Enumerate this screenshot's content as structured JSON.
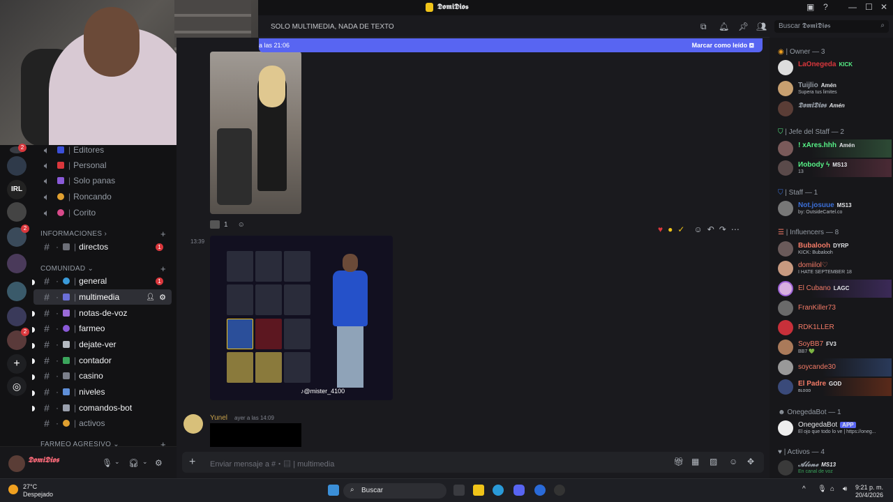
{
  "window": {
    "title": "𝕯𝖔𝖒𝖎𝕯𝖎𝖔𝖘",
    "min": "—",
    "max": "☐",
    "close": "✕"
  },
  "header": {
    "channel": "SOLO MULTIMEDIA, NADA DE TEXTO",
    "search_placeholder": "Buscar 𝕯𝖔𝖒𝖎𝕯𝖎𝖔𝖘"
  },
  "banner": {
    "left": "a las 21:06",
    "right": "Marcar como leído"
  },
  "voice_channels": [
    {
      "label": "Editores",
      "color": "#3b4fd8"
    },
    {
      "label": "Personal",
      "color": "#da373c"
    },
    {
      "label": "Solo panas",
      "color": "#8a5ad8"
    },
    {
      "label": "Roncando",
      "color": "#e0a030"
    },
    {
      "label": "Corito",
      "color": "#d84a8a"
    }
  ],
  "categories": {
    "info": "INFORMACIONES",
    "community": "COMUNIDAD",
    "farm": "FARMEO AGRESIVO"
  },
  "info_channels": [
    {
      "label": "directos",
      "mention": "1",
      "color": "#6d6f78"
    }
  ],
  "community_channels": [
    {
      "label": "general",
      "mention": "1",
      "color": "#3a9ad9"
    },
    {
      "label": "multimedia",
      "color": "#6b70d8"
    },
    {
      "label": "notas-de-voz",
      "color": "#9a6bd8"
    },
    {
      "label": "farmeo",
      "color": "#8a5ad8"
    },
    {
      "label": "dejate-ver",
      "color": "#b5bac1"
    },
    {
      "label": "contador",
      "color": "#3ba55c"
    },
    {
      "label": "casino",
      "color": "#7b7f8a"
    },
    {
      "label": "niveles",
      "color": "#5f8fd8"
    },
    {
      "label": "comandos-bot",
      "color": "#9aa0ad"
    },
    {
      "label": "activos",
      "color": "#e0a030"
    }
  ],
  "user": {
    "name": "𝕯𝖔𝖒𝖎𝕯𝖎𝖔𝖘"
  },
  "messages": {
    "reaction_count": "1",
    "time": "13:39",
    "tiktok": "♪@mister_4100",
    "next_author": "Yunel",
    "next_time": "ayer a las 14:09"
  },
  "input": {
    "placeholder": "Enviar mensaje a #・▤ | multimedia"
  },
  "members": {
    "groups": [
      {
        "label": "| Owner — 3"
      },
      {
        "label": "| Jefe del Staff — 2"
      },
      {
        "label": "| Staff — 1"
      },
      {
        "label": "| Influencers — 8"
      },
      {
        "label": "OnegedaBot — 1"
      },
      {
        "label": "| Activos — 4"
      }
    ],
    "list": [
      {
        "name": "LaOnegeda",
        "tag": "KICK",
        "sub": "",
        "color": "#da373c"
      },
      {
        "name": "Tuijlio",
        "tag": "Amén",
        "sub": "Supera tus limites",
        "color": "#949ba4"
      },
      {
        "name": "𝕯𝖔𝖒𝖎𝕯𝖎𝖔𝖘",
        "tag": "Amén",
        "sub": "",
        "color": "#949ba4"
      },
      {
        "name": "! xAres.hhh",
        "tag": "Amén",
        "sub": "",
        "color": "#57f287"
      },
      {
        "name": "Иobody ϟ",
        "tag": "MS13",
        "sub": "13",
        "color": "#57f287"
      },
      {
        "name": "Not.josuue",
        "tag": "MS13",
        "sub": "by: OutsideCartel.co",
        "color": "#3b6fd8"
      },
      {
        "name": "Bubalooh",
        "tag": "DYRP",
        "sub": "KICK: Bubalooh",
        "color": "#f47b67"
      },
      {
        "name": "domiilol♡",
        "tag": "",
        "sub": "I HATE SEPTEMBER 18",
        "color": "#f47b67"
      },
      {
        "name": "El Cubano",
        "tag": "LAGC",
        "sub": "",
        "color": "#f47b67"
      },
      {
        "name": "FranKiller73",
        "tag": "",
        "sub": "",
        "color": "#f47b67"
      },
      {
        "name": "RDK1LLER",
        "tag": "",
        "sub": "",
        "color": "#f47b67"
      },
      {
        "name": "SoyBB7",
        "tag": "FV3",
        "sub": "BB7 💚",
        "color": "#f47b67"
      },
      {
        "name": "soycande30",
        "tag": "",
        "sub": "",
        "color": "#f47b67"
      },
      {
        "name": "El Padre",
        "tag": "GOD",
        "sub": "ʙʟᴏᴏᴅ",
        "color": "#f47b67"
      },
      {
        "name": "OnegedaBot",
        "tag": "APP",
        "sub": "El ojo que todo lo ve | https://oneg...",
        "color": "#e5e6e8"
      },
      {
        "name": "𝓐𝓵𝓸𝓷𝓮",
        "tag": "MS13",
        "sub": "En canal de voz",
        "color": "#949ba4"
      }
    ]
  },
  "taskbar": {
    "temp": "27°C",
    "weather": "Despejado",
    "search": "Buscar",
    "time": "9:21 p. m.",
    "date": "20/4/2026"
  }
}
